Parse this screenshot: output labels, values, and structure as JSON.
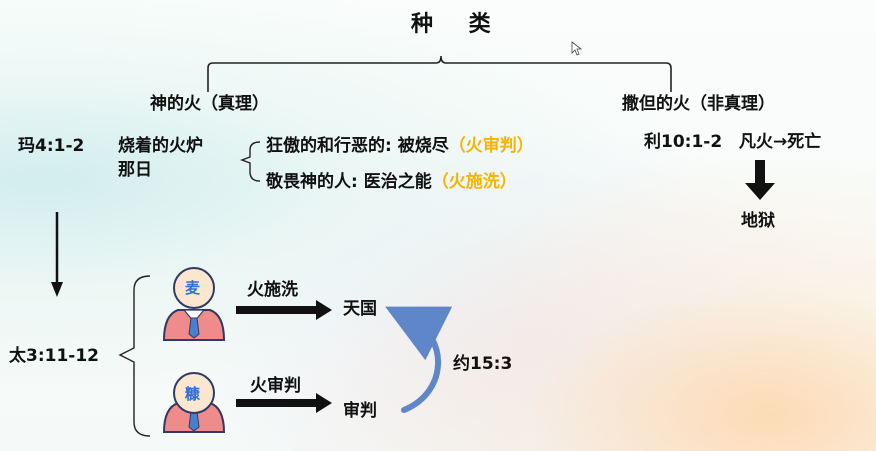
{
  "title": "种 类",
  "left_branch": {
    "label": "神的火（真理）"
  },
  "right_branch": {
    "label": "撒但的火（非真理）"
  },
  "malachi": {
    "ref": "玛4:1-2",
    "line1": "烧着的火炉",
    "line2": "那日",
    "item1_text": "狂傲的和行恶的: 被烧尽",
    "item1_tag": "（火审判）",
    "item2_text": "敬畏神的人: 医治之能",
    "item2_tag": "（火施洗）"
  },
  "leviticus": {
    "ref": "利10:1-2",
    "text": "凡火→死亡",
    "result": "地狱"
  },
  "matthew": {
    "ref": "太3:11-12",
    "wheat_label": "麦",
    "chaff_label": "糠",
    "arrow1_label": "火施洗",
    "arrow1_target": "天国",
    "arrow2_label": "火审判",
    "arrow2_target": "审判",
    "cross_ref": "约15:3"
  },
  "colors": {
    "orange_accent": "#f5b400",
    "person_outline": "#2f3b63",
    "person_face": "#fbe7cf",
    "person_shirt": "#ef8b8b",
    "tie": "#4a7fd0",
    "badge_text": "#2f6fd6",
    "curve_arrow": "#5f86c9"
  }
}
